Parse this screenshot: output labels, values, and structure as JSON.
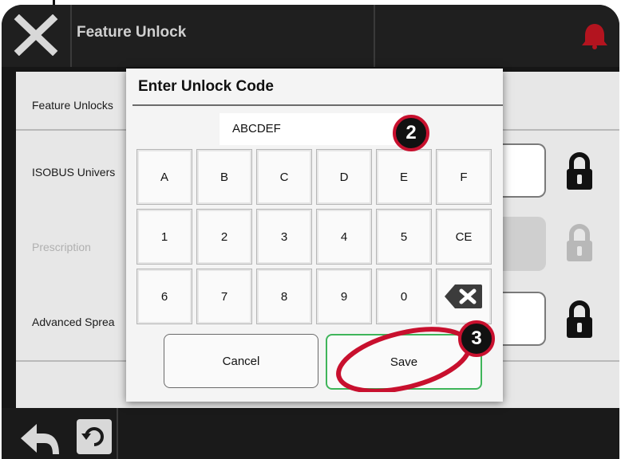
{
  "header": {
    "title": "Feature Unlock",
    "close_icon": "close-x-icon",
    "alert_icon": "alert-icon"
  },
  "feature_rows": [
    {
      "label": "Feature Unlocks",
      "state": "header"
    },
    {
      "label": "ISOBUS Univers",
      "state": "locked"
    },
    {
      "label": "Prescription",
      "state": "disabled"
    },
    {
      "label": "Advanced Sprea",
      "state": "locked"
    }
  ],
  "dialog": {
    "title": "Enter Unlock Code",
    "code_value": "ABCDEF",
    "keys_row1": [
      "A",
      "B",
      "C",
      "D",
      "E",
      "F"
    ],
    "keys_row2": [
      "1",
      "2",
      "3",
      "4",
      "5",
      "CE"
    ],
    "keys_row3": [
      "6",
      "7",
      "8",
      "9",
      "0"
    ],
    "backspace_icon": "backspace-icon",
    "cancel_label": "Cancel",
    "save_label": "Save"
  },
  "callouts": {
    "code": "2",
    "save": "3"
  },
  "footer": {
    "back_icon": "back-arrow-icon",
    "reset_icon": "reset-icon"
  },
  "colors": {
    "accent_red": "#c8102e",
    "save_border": "#3fb55a",
    "frame": "#161616"
  }
}
